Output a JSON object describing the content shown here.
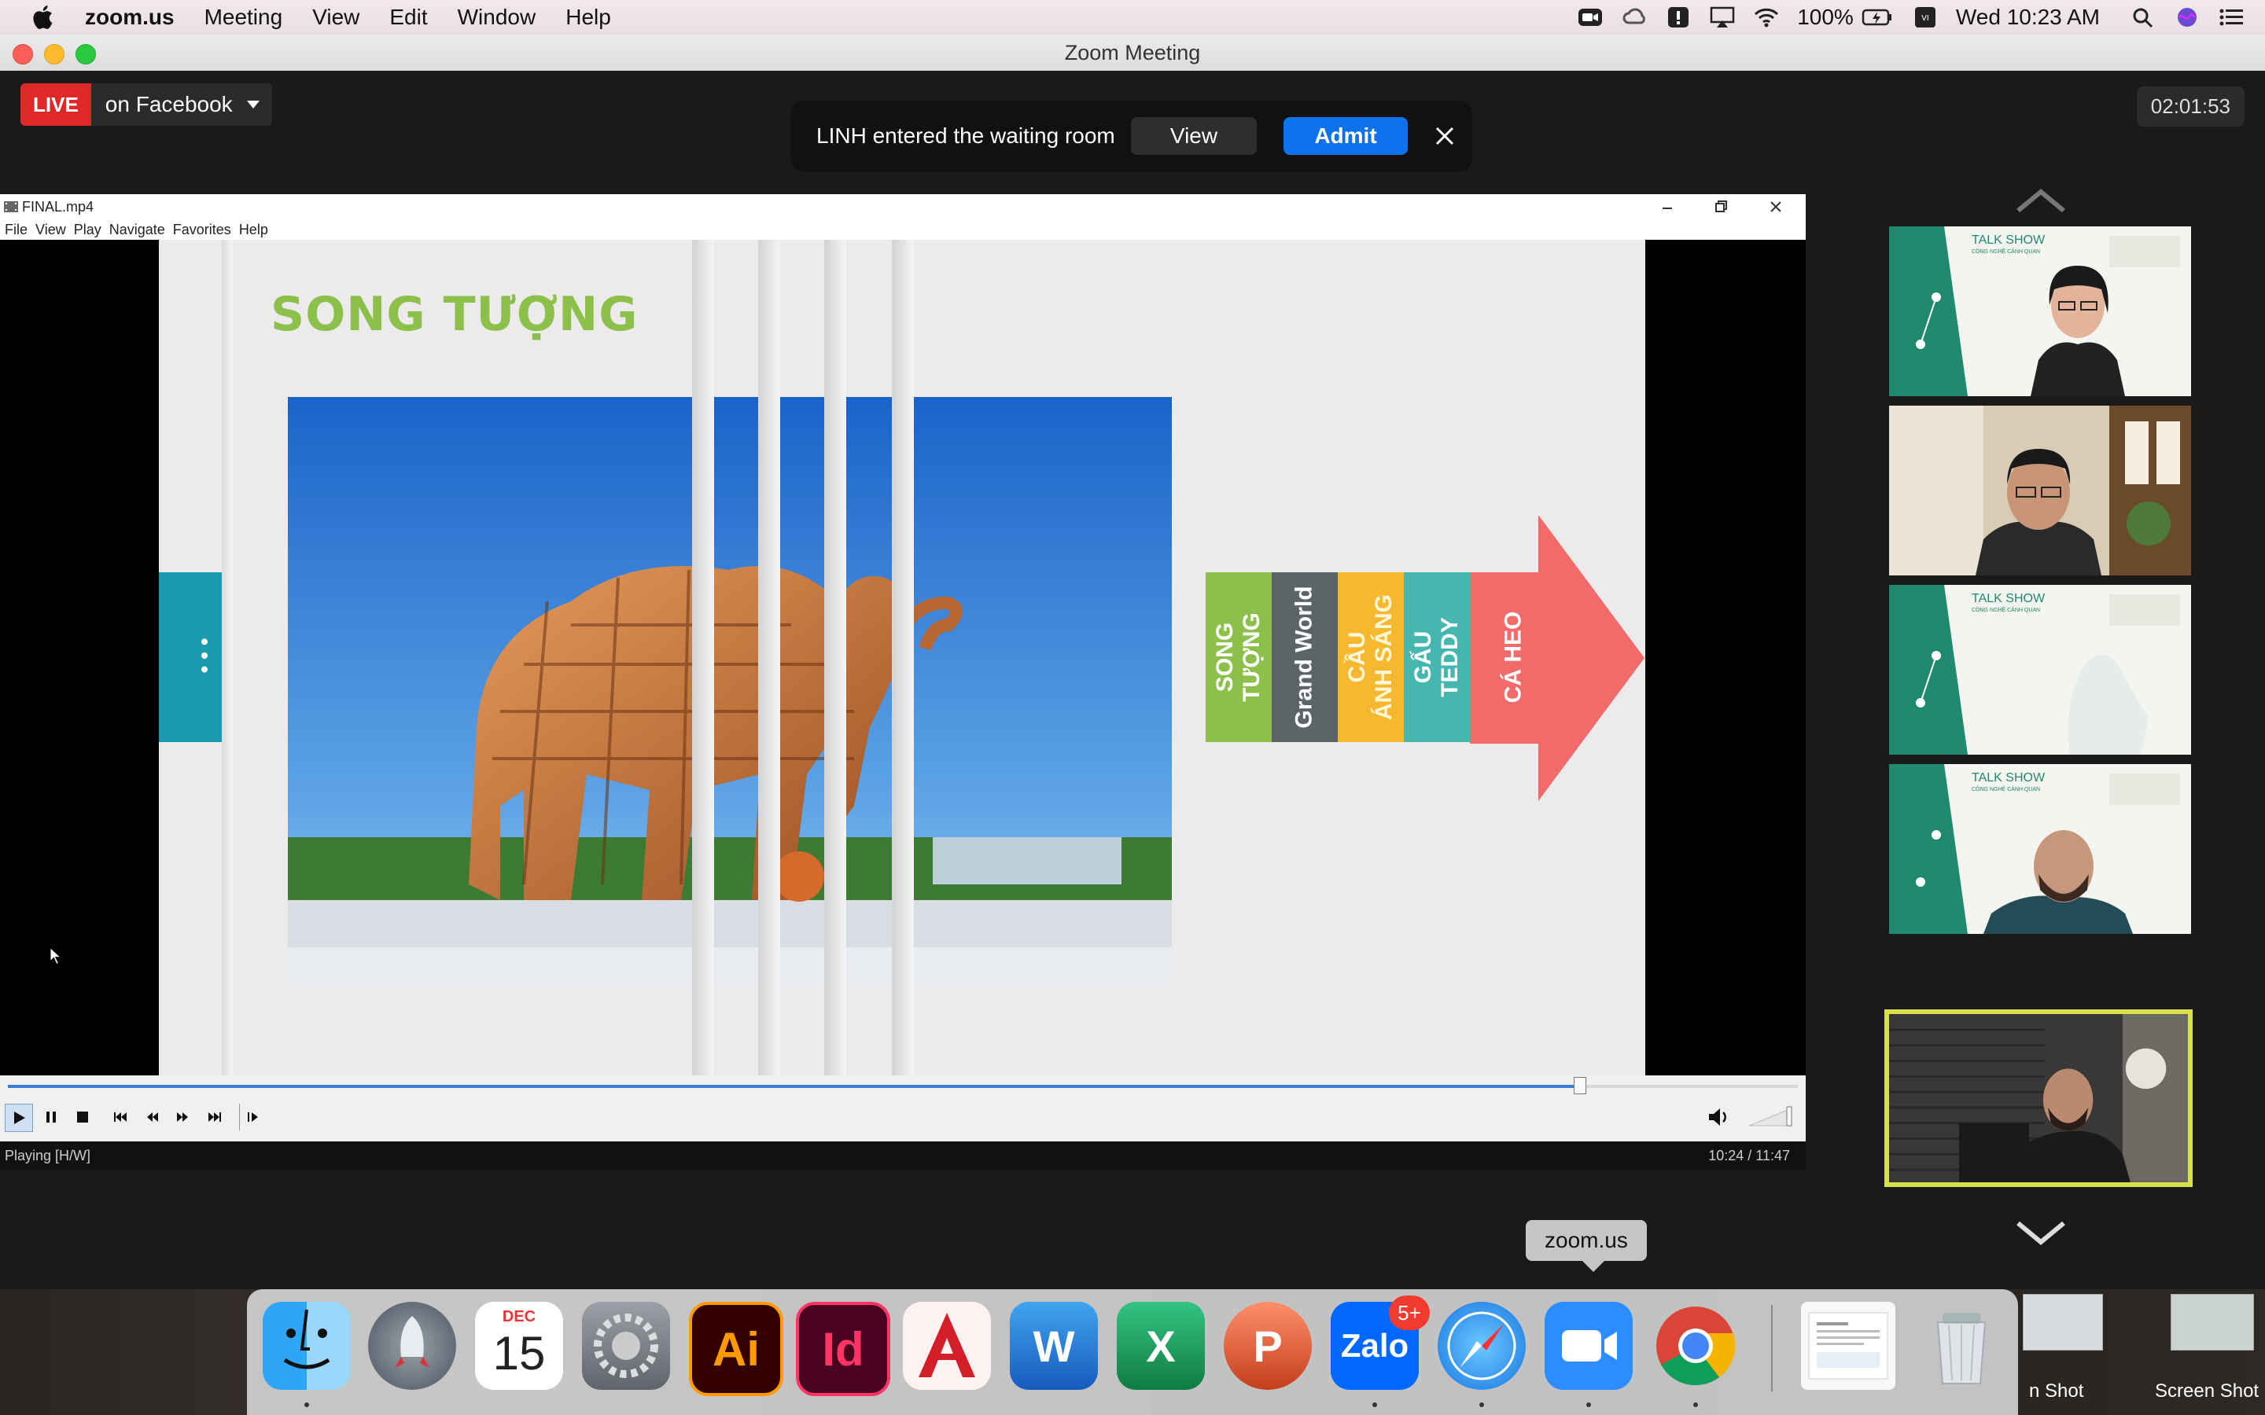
{
  "menubar": {
    "app_name": "zoom.us",
    "items": [
      "Meeting",
      "View",
      "Edit",
      "Window",
      "Help"
    ],
    "battery": "100%",
    "clock": "Wed 10:23 AM"
  },
  "window": {
    "title": "Zoom Meeting"
  },
  "live": {
    "badge": "LIVE",
    "label": "on Facebook"
  },
  "timer": "02:01:53",
  "notification": {
    "message": "LINH entered the waiting room",
    "view_label": "View",
    "admit_label": "Admit"
  },
  "player": {
    "file_title": "FINAL.mp4",
    "menu": [
      "File",
      "View",
      "Play",
      "Navigate",
      "Favorites",
      "Help"
    ],
    "status": "Playing [H/W]",
    "time": "10:24 / 11:47",
    "progress": 0.878
  },
  "slide": {
    "heading": "SONG TƯỢNG",
    "tabs": [
      {
        "label": "SONG\nTƯỢNG",
        "color": "#8cc04b"
      },
      {
        "label": "Grand World",
        "color": "#5b6466"
      },
      {
        "label": "CẦU\nÁNH SÁNG",
        "color": "#f5b82e"
      },
      {
        "label": "GẤU\nTEDDY",
        "color": "#46b6b0"
      },
      {
        "label": "CÁ HEO",
        "color": "#f26b6b"
      }
    ]
  },
  "gallery": {
    "participants": [
      "talkshow-host",
      "participant-glasses-man",
      "talkshow-card",
      "participant-bald-man",
      "participant-active-speaker"
    ],
    "thumb_text": "TALK SHOW",
    "thumb_subtext": "CÔNG NGHỆ CẢNH QUAN"
  },
  "dock": {
    "tooltip": "zoom.us",
    "calendar_month": "DEC",
    "calendar_day": "15",
    "zalo_badge": "5+",
    "apps": [
      "finder",
      "launchpad",
      "calendar",
      "system-preferences",
      "illustrator",
      "indesign",
      "autocad",
      "word",
      "excel",
      "powerpoint",
      "zalo",
      "safari",
      "zoom",
      "chrome",
      "downloads",
      "trash"
    ],
    "desktop_labels": [
      "n Shot",
      "Screen Shot"
    ]
  }
}
